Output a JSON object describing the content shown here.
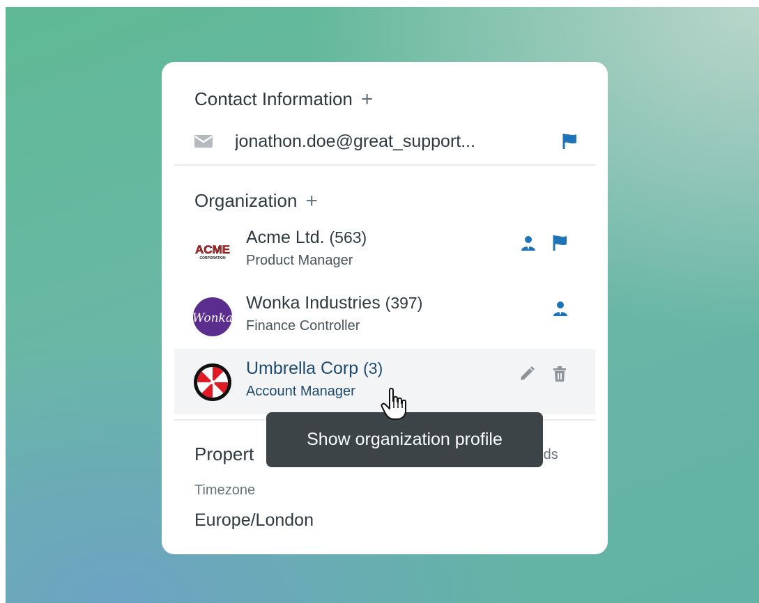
{
  "contact": {
    "title": "Contact Information",
    "add_icon": "plus-icon",
    "email": "jonathon.doe@great_support...",
    "email_icon": "envelope-icon",
    "flag_icon": "flag-icon"
  },
  "organization": {
    "title": "Organization",
    "add_icon": "plus-icon",
    "items": [
      {
        "name": "Acme Ltd.",
        "count": "(563)",
        "role": "Product Manager",
        "logo_text": "ACME",
        "logo_subtext": "CORPORATION",
        "icons": [
          "person-icon",
          "flag-icon"
        ]
      },
      {
        "name": "Wonka Industries",
        "count": "(397)",
        "role": "Finance Controller",
        "logo_text": "Wonka",
        "icons": [
          "person-icon"
        ]
      },
      {
        "name": "Umbrella Corp",
        "count": "(3)",
        "role": "Account Manager",
        "icons": [
          "pencil-icon",
          "trash-icon"
        ]
      }
    ]
  },
  "tooltip": {
    "text": "Show organization profile"
  },
  "properties": {
    "title": "Propert",
    "fields_link": "elds",
    "timezone_label": "Timezone",
    "timezone_value": "Europe/London"
  },
  "colors": {
    "accent": "#1f73b7",
    "hover_row": "#f3f4f6",
    "tooltip_bg": "#3d4448",
    "wonka_purple": "#5b2d8e",
    "umbrella_red": "#e01b24"
  }
}
